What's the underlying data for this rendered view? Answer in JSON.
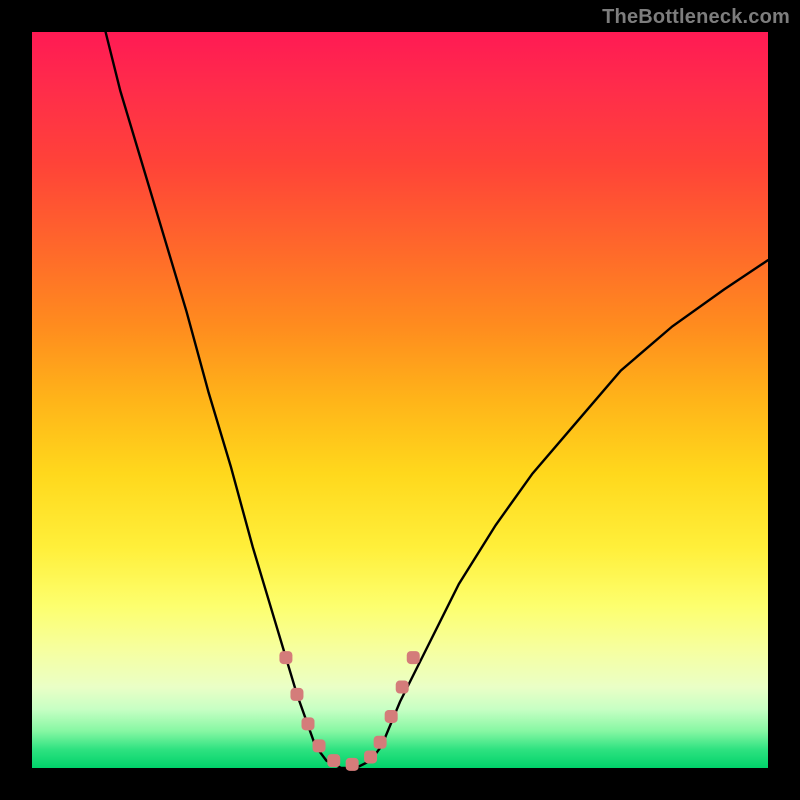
{
  "watermark": "TheBottleneck.com",
  "colors": {
    "frame_bg": "#000000",
    "watermark": "#7d7d7d",
    "curve": "#000000",
    "marker": "#d47c7a",
    "gradient_top": "#ff1a54",
    "gradient_bottom": "#00d26a"
  },
  "chart_data": {
    "type": "line",
    "title": "",
    "xlabel": "",
    "ylabel": "",
    "xlim": [
      0,
      100
    ],
    "ylim": [
      0,
      100
    ],
    "grid": false,
    "legend": false,
    "note": "Bottleneck-style curve on rainbow gradient. Axes unlabeled; values estimated from pixel positions within the 736×736 plot area. x and y given as percentages of the plot area (0 = left/bottom, 100 = right/top).",
    "series": [
      {
        "name": "left-branch",
        "x": [
          10,
          12,
          15,
          18,
          21,
          24,
          27,
          30,
          33,
          36,
          38.5
        ],
        "y": [
          100,
          92,
          82,
          72,
          62,
          51,
          41,
          30,
          20,
          10,
          3
        ]
      },
      {
        "name": "valley",
        "x": [
          38.5,
          40,
          42,
          44,
          46,
          47.5
        ],
        "y": [
          3,
          1,
          0,
          0,
          1,
          3
        ]
      },
      {
        "name": "right-branch",
        "x": [
          47.5,
          50,
          54,
          58,
          63,
          68,
          74,
          80,
          87,
          94,
          100
        ],
        "y": [
          3,
          9,
          17,
          25,
          33,
          40,
          47,
          54,
          60,
          65,
          69
        ]
      }
    ],
    "markers": {
      "name": "highlighted-points",
      "color": "#d47c7a",
      "x": [
        34.5,
        36,
        37.5,
        39,
        41,
        43.5,
        46,
        47.3,
        48.8,
        50.3,
        51.8
      ],
      "y": [
        15,
        10,
        6,
        3,
        1,
        0.5,
        1.5,
        3.5,
        7,
        11,
        15
      ]
    }
  }
}
